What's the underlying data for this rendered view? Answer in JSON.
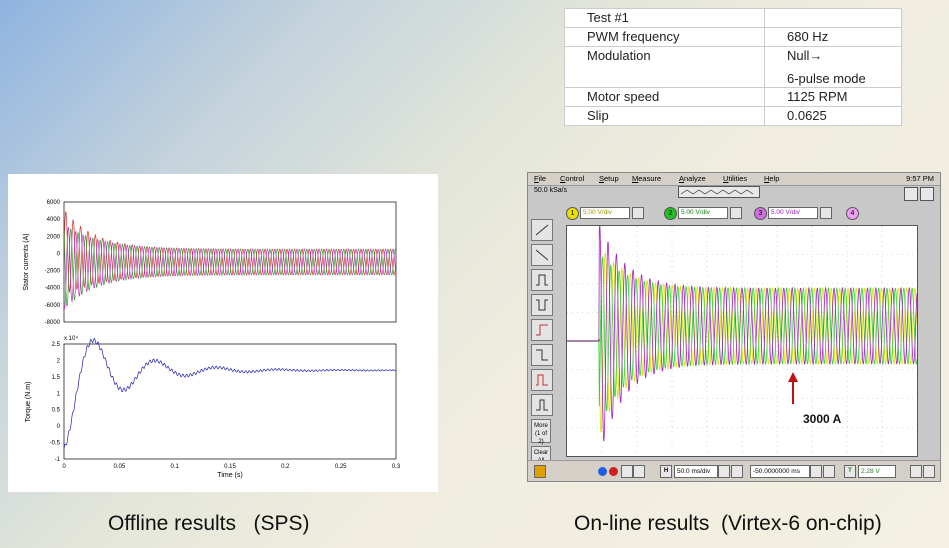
{
  "params_table": {
    "rows": [
      {
        "label": "Test #1",
        "value": ""
      },
      {
        "label": "PWM frequency",
        "value": "680 Hz"
      },
      {
        "label": "Modulation",
        "value": "Null→",
        "value2": "6-pulse mode"
      },
      {
        "label": "Motor speed",
        "value": "1125 RPM"
      },
      {
        "label": "Slip",
        "value": "0.0625"
      }
    ]
  },
  "captions": {
    "offline": "Offline results   (SPS)",
    "online": "On-line results  (Virtex-6 on-chip)"
  },
  "offline_plot": {
    "top": {
      "ylabel": "Stator currents (A)",
      "yticks": [
        "6000",
        "4000",
        "2000",
        "0",
        "-2000",
        "-4000",
        "-6000",
        "-8000"
      ]
    },
    "bottom": {
      "ylabel": "Torque (N.m)",
      "exponent": "x 10⁴",
      "yticks": [
        "2.5",
        "2",
        "1.5",
        "1",
        "0.5",
        "0",
        "-0.5",
        "-1"
      ],
      "xticks": [
        "0",
        "0.05",
        "0.1",
        "0.15",
        "0.2",
        "0.25",
        "0.3"
      ],
      "xlabel": "Time (s)"
    },
    "colors": {
      "phase_a": "#d03030",
      "phase_b": "#2aa02a",
      "phase_c": "#c030c0",
      "torque": "#2020b0"
    }
  },
  "scope": {
    "menu": [
      "File",
      "Control",
      "Setup",
      "Measure",
      "Analyze",
      "Utilities",
      "Help"
    ],
    "clock": "9:57 PM",
    "sample_rate": "50.0 kSa/s",
    "channels": [
      {
        "num": "1",
        "scale": "5.00 V/div",
        "color": "#e8e000"
      },
      {
        "num": "2",
        "scale": "5.00 V/div",
        "color": "#20c020"
      },
      {
        "num": "3",
        "scale": "5.00 V/div",
        "color": "#b020c0"
      },
      {
        "num": "4",
        "scale": "",
        "color": "#f0a0f0"
      }
    ],
    "sidebar_more": "More (1 of 2)",
    "sidebar_clear": "Clear All",
    "timebase": "50.0 ms/div",
    "delay": "-50.0000000 ms",
    "trigger_level": "2.28 V",
    "annotation": "3000 A",
    "trace_colors": {
      "yellow": "#e0e000",
      "green": "#30d030",
      "purple": "#a020c0",
      "black": "#000000"
    }
  }
}
